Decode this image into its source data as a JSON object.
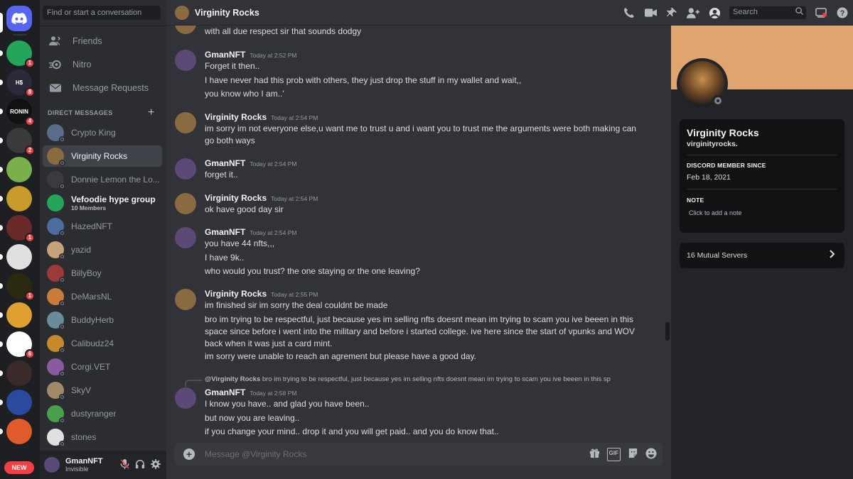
{
  "conversation_search": {
    "placeholder": "Find or start a conversation"
  },
  "nav": {
    "friends": "Friends",
    "nitro": "Nitro",
    "message_requests": "Message Requests"
  },
  "direct_messages_header": "DIRECT MESSAGES",
  "dm_list": [
    {
      "name": "Crypto King",
      "color": "#5b6b8a"
    },
    {
      "name": "Virginity Rocks",
      "color": "#8a6a40"
    },
    {
      "name": "Donnie Lemon the Lo...",
      "color": "#3a3b40"
    },
    {
      "name": "Vefoodie hype group",
      "sub": "10 Members",
      "color": "#23a55a"
    },
    {
      "name": "HazedNFT",
      "color": "#4b6c9c"
    },
    {
      "name": "yazid",
      "color": "#c6a27b"
    },
    {
      "name": "BillyBoy",
      "color": "#9c3a3a"
    },
    {
      "name": "DeMarsNL",
      "color": "#c97b3a"
    },
    {
      "name": "BuddyHerb",
      "color": "#6a8c9a"
    },
    {
      "name": "Calibudz24",
      "color": "#c78a2a"
    },
    {
      "name": "Corgi.VET",
      "color": "#8a5aa0"
    },
    {
      "name": "SkyV",
      "color": "#a08a6a"
    },
    {
      "name": "dustyranger",
      "color": "#4aa04a"
    },
    {
      "name": "stones",
      "color": "#e0e0e0"
    }
  ],
  "servers": [
    {
      "initials": "",
      "color": "#23a55a",
      "badge": "1"
    },
    {
      "initials": "H$",
      "color": "#2a2a3a",
      "badge": "8"
    },
    {
      "initials": "RONIN",
      "color": "#111111",
      "badge": "4"
    },
    {
      "initials": "",
      "color": "#3a3a3a",
      "badge": "2"
    },
    {
      "initials": "",
      "color": "#7ab04a",
      "badge": ""
    },
    {
      "initials": "",
      "color": "#c79a2a",
      "badge": ""
    },
    {
      "initials": "",
      "color": "#6a2a2a",
      "badge": "1"
    },
    {
      "initials": "",
      "color": "#e0e0e0",
      "badge": ""
    },
    {
      "initials": "",
      "color": "#2a2a10",
      "badge": "1"
    },
    {
      "initials": "",
      "color": "#e0a030",
      "badge": ""
    },
    {
      "initials": "",
      "color": "#ffffff",
      "badge": "6"
    },
    {
      "initials": "",
      "color": "#3a2a2a",
      "badge": ""
    },
    {
      "initials": "",
      "color": "#2a4aa0",
      "badge": ""
    },
    {
      "initials": "",
      "color": "#e05a2a",
      "badge": ""
    }
  ],
  "new_label": "NEW",
  "user_panel": {
    "name": "GmanNFT",
    "status": "Invisible"
  },
  "header": {
    "title": "Virginity Rocks",
    "search_placeholder": "Search"
  },
  "messages": [
    {
      "lines": [
        "with all due respect sir that sounds dodgy"
      ]
    },
    {
      "author": "GmanNFT",
      "time": "Today at 2:52 PM",
      "lines": [
        "Forget it then..",
        "I have never had this prob with others, they just drop the stuff in my wallet and wait,,",
        "you know who I am..'"
      ]
    },
    {
      "author": "Virginity Rocks",
      "time": "Today at 2:54 PM",
      "lines": [
        "im sorry im not everyone else,u want me to trust u and i want you to trust me the arguments were both making can go both ways"
      ]
    },
    {
      "author": "GmanNFT",
      "time": "Today at 2:54 PM",
      "lines": [
        "forget it.."
      ]
    },
    {
      "author": "Virginity Rocks",
      "time": "Today at 2:54 PM",
      "lines": [
        "ok have good day sir"
      ]
    },
    {
      "author": "GmanNFT",
      "time": "Today at 2:54 PM",
      "lines": [
        "you have 44 nfts,,,",
        "I have 9k..",
        "who would you trust? the one staying or the one leaving?"
      ]
    },
    {
      "author": "Virginity Rocks",
      "time": "Today at 2:55 PM",
      "lines": [
        "im finished sir im sorry the deal couldnt be made",
        "bro im trying to be respectful, just because yes im selling nfts doesnt mean im trying to scam you ive beeen in this space since before i went into the military and before i started college. ive here since the start of vpunks and WOV back when it was just a card mint.",
        "im sorry were unable to reach an agrement but please have a good day."
      ]
    },
    {
      "reply_to": "@Virginity Rocks",
      "reply_text": "bro im trying to be respectful, just because yes im selling nfts doesnt mean im trying to scam you ive beeen in this sp",
      "author": "GmanNFT",
      "time": "Today at 2:58 PM",
      "lines": [
        "I know you have.. and glad you have been..",
        "but now you are leaving..",
        "if you change your mind.. drop it and you will get paid.. and you do know that.."
      ]
    }
  ],
  "composer": {
    "placeholder": "Message @Virginity Rocks",
    "gif_label": "GIF"
  },
  "profile": {
    "display_name": "Virginity Rocks",
    "username": "virginityrocks.",
    "member_since_label": "DISCORD MEMBER SINCE",
    "member_since": "Feb 18, 2021",
    "note_label": "NOTE",
    "note_placeholder": "Click to add a note",
    "mutual_servers": "16 Mutual Servers",
    "banner_color": "#e0a56f"
  },
  "colors": {
    "blurple": "#5865f2",
    "red": "#f23f43",
    "green": "#23a55a"
  }
}
